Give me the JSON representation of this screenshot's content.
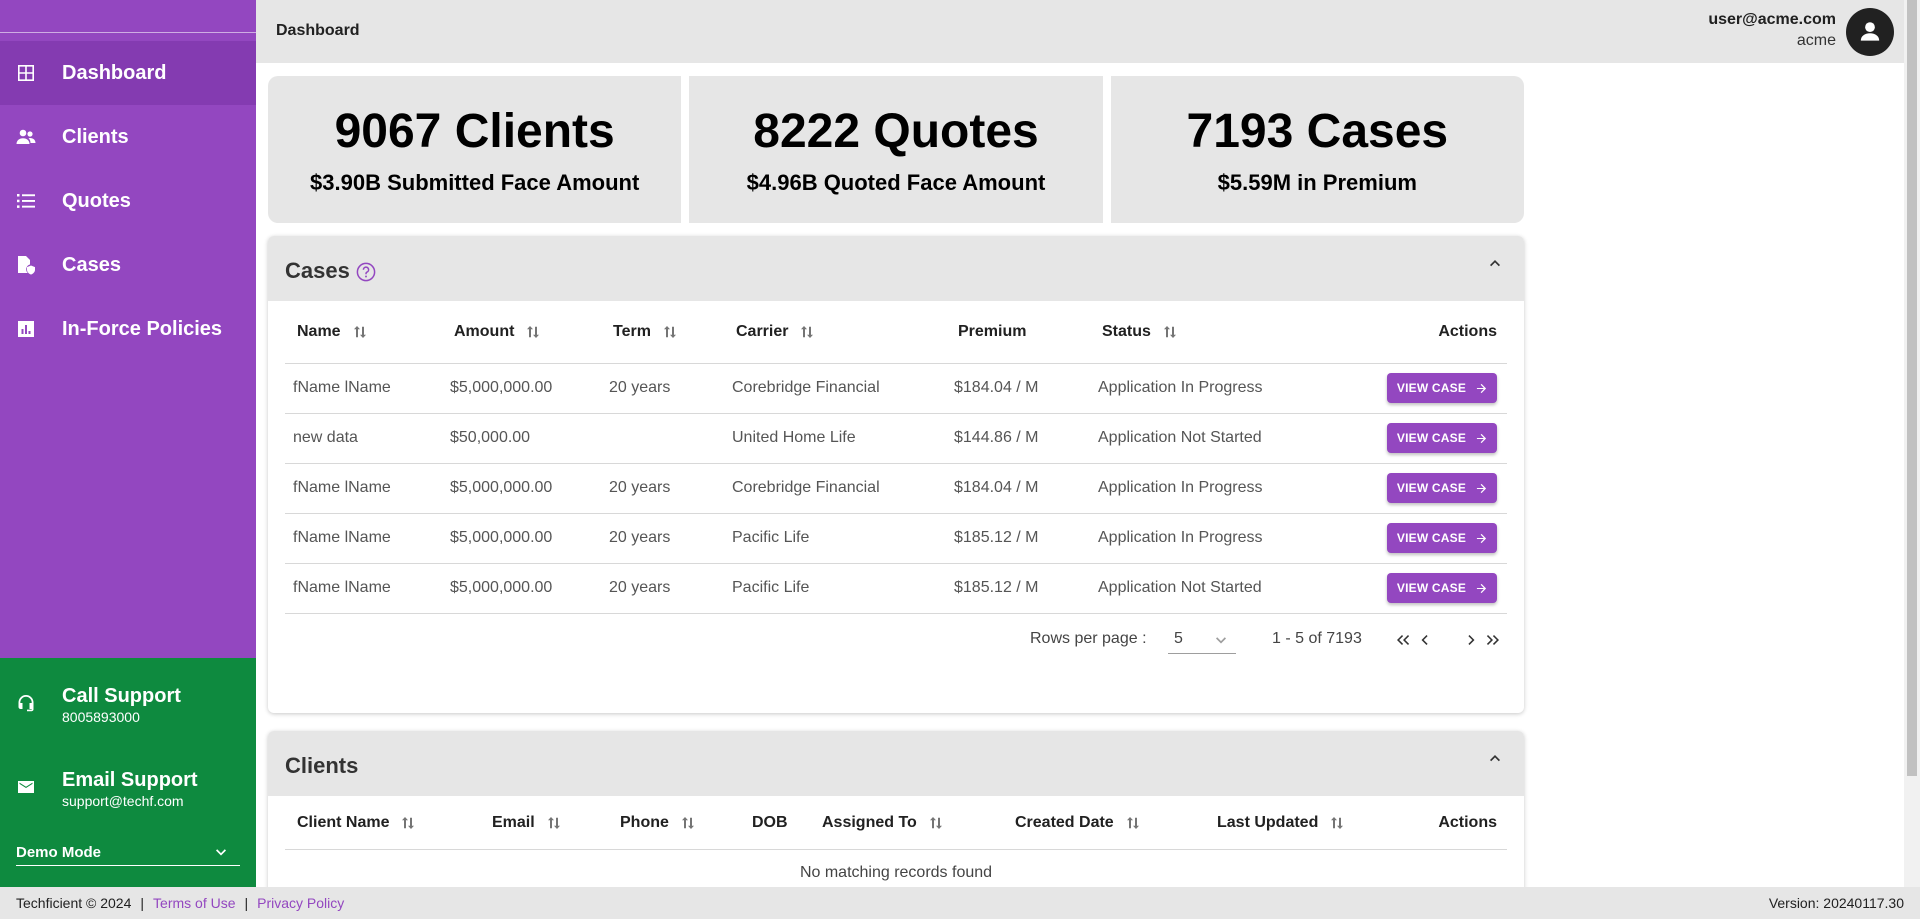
{
  "header": {
    "title": "Dashboard",
    "user_email": "user@acme.com",
    "user_org": "acme"
  },
  "sidebar": {
    "items": [
      {
        "label": "Dashboard",
        "icon": "dashboard-icon",
        "active": true
      },
      {
        "label": "Clients",
        "icon": "people-icon"
      },
      {
        "label": "Quotes",
        "icon": "list-icon"
      },
      {
        "label": "Cases",
        "icon": "case-icon"
      },
      {
        "label": "In-Force Policies",
        "icon": "chart-icon"
      }
    ],
    "support": {
      "call_title": "Call Support",
      "call_value": "8005893000",
      "email_title": "Email Support",
      "email_value": "support@techf.com",
      "demo_mode": "Demo Mode"
    }
  },
  "stats": [
    {
      "main": "9067 Clients",
      "sub": "$3.90B Submitted Face Amount"
    },
    {
      "main": "8222 Quotes",
      "sub": "$4.96B Quoted Face Amount"
    },
    {
      "main": "7193 Cases",
      "sub": "$5.59M in Premium"
    }
  ],
  "cases": {
    "title": "Cases",
    "columns": [
      "Name",
      "Amount",
      "Term",
      "Carrier",
      "Premium",
      "Status",
      "Actions"
    ],
    "rows": [
      {
        "name": "fName lName",
        "amount": "$5,000,000.00",
        "term": "20 years",
        "carrier": "Corebridge Financial",
        "premium": "$184.04 / M",
        "status": "Application In Progress"
      },
      {
        "name": "new data",
        "amount": "$50,000.00",
        "term": "",
        "carrier": "United Home Life",
        "premium": "$144.86 / M",
        "status": "Application Not Started"
      },
      {
        "name": "fName lName",
        "amount": "$5,000,000.00",
        "term": "20 years",
        "carrier": "Corebridge Financial",
        "premium": "$184.04 / M",
        "status": "Application In Progress"
      },
      {
        "name": "fName lName",
        "amount": "$5,000,000.00",
        "term": "20 years",
        "carrier": "Pacific Life",
        "premium": "$185.12 / M",
        "status": "Application In Progress"
      },
      {
        "name": "fName lName",
        "amount": "$5,000,000.00",
        "term": "20 years",
        "carrier": "Pacific Life",
        "premium": "$185.12 / M",
        "status": "Application Not Started"
      }
    ],
    "view_label": "VIEW CASE",
    "pager": {
      "rows_label": "Rows per page :",
      "rows_value": "5",
      "range": "1 - 5 of 7193"
    }
  },
  "clients": {
    "title": "Clients",
    "columns": [
      "Client Name",
      "Email",
      "Phone",
      "DOB",
      "Assigned To",
      "Created Date",
      "Last Updated",
      "Actions"
    ],
    "empty": "No matching records found"
  },
  "footer": {
    "copyright": "Techficient © 2024",
    "terms": "Terms of Use",
    "privacy": "Privacy Policy",
    "version": "Version: 20240117.30"
  },
  "colors": {
    "sidebar": "#9347c0",
    "support": "#0e8a3f",
    "accent": "#9347c0"
  }
}
